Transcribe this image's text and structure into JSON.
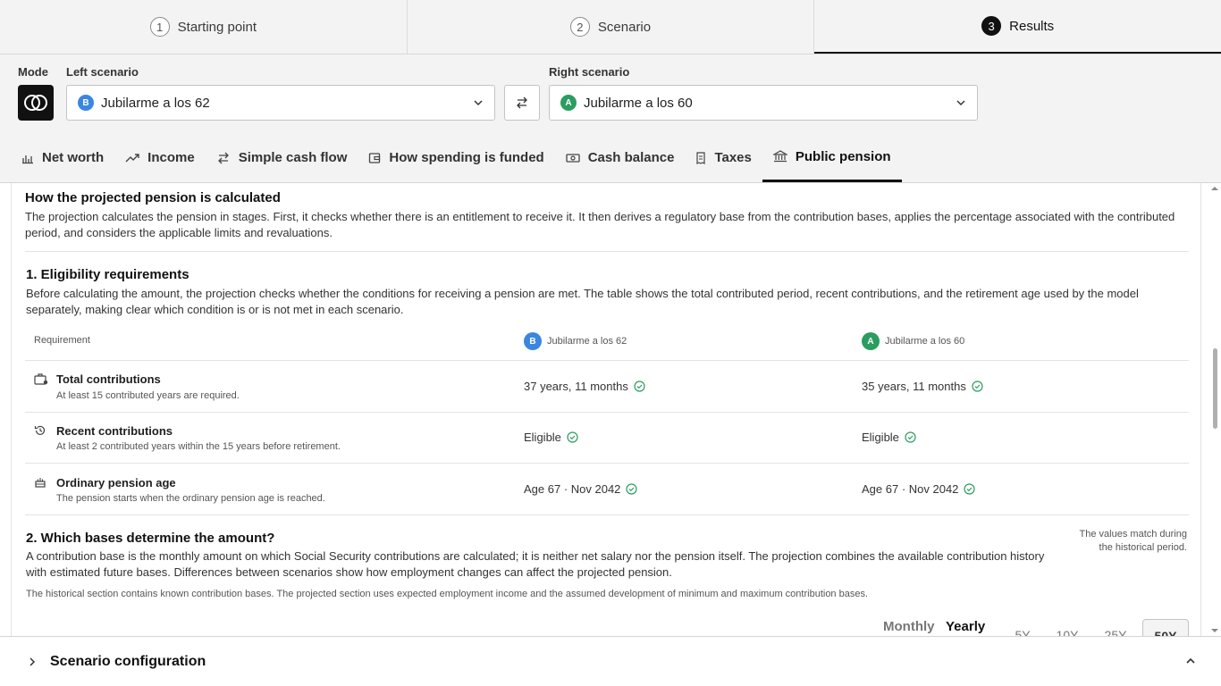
{
  "steps": [
    {
      "num": "1",
      "label": "Starting point"
    },
    {
      "num": "2",
      "label": "Scenario"
    },
    {
      "num": "3",
      "label": "Results"
    }
  ],
  "mode": {
    "label": "Mode"
  },
  "left_scenario": {
    "label": "Left scenario",
    "badge": "B",
    "value": "Jubilarme a los 62"
  },
  "right_scenario": {
    "label": "Right scenario",
    "badge": "A",
    "value": "Jubilarme a los 60"
  },
  "tabs": [
    {
      "label": "Net worth",
      "icon": "bar-chart-icon"
    },
    {
      "label": "Income",
      "icon": "trend-up-icon"
    },
    {
      "label": "Simple cash flow",
      "icon": "swap-arrows-icon"
    },
    {
      "label": "How spending is funded",
      "icon": "wallet-icon"
    },
    {
      "label": "Cash balance",
      "icon": "cash-icon"
    },
    {
      "label": "Taxes",
      "icon": "receipt-icon"
    },
    {
      "label": "Public pension",
      "icon": "bank-icon"
    }
  ],
  "content": {
    "title": "How the projected pension is calculated",
    "intro": "The projection calculates the pension in stages. First, it checks whether there is an entitlement to receive it. It then derives a regulatory base from the contribution bases, applies the percentage associated with the contributed period, and considers the applicable limits and revaluations.",
    "section1": {
      "title": "1. Eligibility requirements",
      "desc": "Before calculating the amount, the projection checks whether the conditions for receiving a pension are met. The table shows the total contributed period, recent contributions, and the retirement age used by the model separately, making clear which condition is or is not met in each scenario.",
      "headers": {
        "requirement": "Requirement",
        "col_b": "Jubilarme a los 62",
        "col_a": "Jubilarme a los 60"
      },
      "rows": [
        {
          "title": "Total contributions",
          "sub": "At least 15 contributed years are required.",
          "b": "37 years, 11 months",
          "a": "35 years, 11 months"
        },
        {
          "title": "Recent contributions",
          "sub": "At least 2 contributed years within the 15 years before retirement.",
          "b": "Eligible",
          "a": "Eligible"
        },
        {
          "title": "Ordinary pension age",
          "sub": "The pension starts when the ordinary pension age is reached.",
          "b": "Age 67 · Nov 2042",
          "a": "Age 67 · Nov 2042"
        }
      ]
    },
    "section2": {
      "title": "2. Which bases determine the amount?",
      "desc": "A contribution base is the monthly amount on which Social Security contributions are calculated; it is neither net salary nor the pension itself. The projection combines the available contribution history with estimated future bases. Differences between scenarios show how employment changes can affect the projected pension.",
      "note_line1": "The values match during",
      "note_line2": "the historical period.",
      "small": "The historical section contains known contribution bases. The projected section uses expected employment income and the assumed development of minimum and maximum contribution bases.",
      "toggle_monthly": "Monthly",
      "toggle_yearly": "Yearly",
      "ranges": [
        "5Y",
        "10Y",
        "25Y",
        "50Y"
      ]
    }
  },
  "bottom": {
    "title": "Scenario configuration"
  }
}
